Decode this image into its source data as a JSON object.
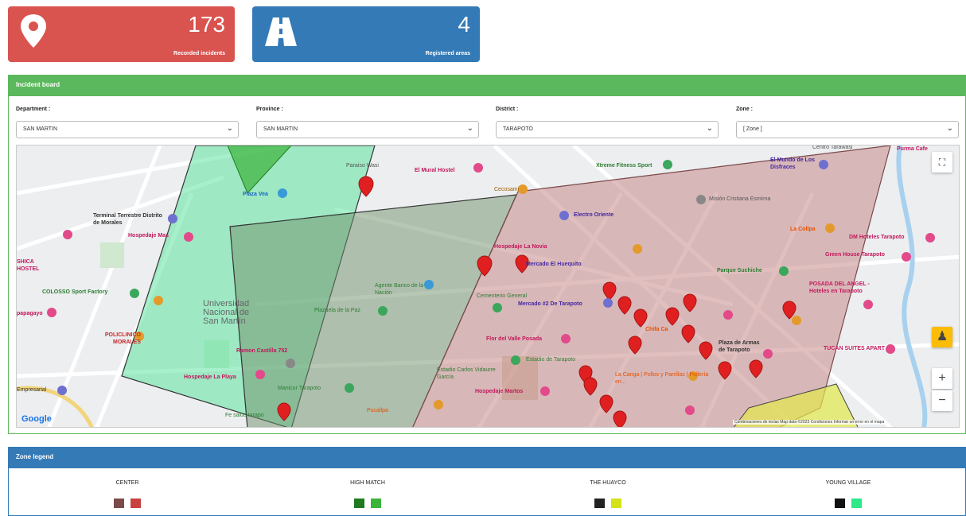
{
  "stats": {
    "incidents": {
      "value": "173",
      "label": "Recorded incidents",
      "color": "#d9534f",
      "icon": "map-pin-icon"
    },
    "areas": {
      "value": "4",
      "label": "Registered areas",
      "color": "#337ab7",
      "icon": "road-icon"
    }
  },
  "board": {
    "title": "Incident board",
    "color": "#5cb85c"
  },
  "filters": {
    "department": {
      "label": "Department :",
      "value": "SAN MARTIN"
    },
    "province": {
      "label": "Province :",
      "value": "SAN MARTIN"
    },
    "district": {
      "label": "District :",
      "value": "TARAPOTO"
    },
    "zone": {
      "label": "Zone :",
      "value": "[ Zone ]"
    }
  },
  "map": {
    "labels": {
      "paraiso": "Paraiso Wasi",
      "mural": "El Mural Hostel",
      "xtreme": "Xtreme Fitness Sport",
      "centro": "Centro Tarawasi",
      "plazavea": "Plaza Vea",
      "cecosami": "Cecosami",
      "electro": "Electro Oriente",
      "mision": "Misión Cristiana Esmirna",
      "terminal": "Terminal Terrestre Distrito de Morales",
      "hospedajemas": "Hospedaje Mas",
      "novia": "Hospedaje La Novia",
      "mercado": "Mercado El Huequito",
      "colpa": "La Collpa",
      "dm": "DM Hoteles Tarapoto",
      "greenhouse": "Green House Tarapoto",
      "suchiche": "Parque Suchiche",
      "shica": "SHICA HOSTEL",
      "colosso": "COLOSSO Sport Factory",
      "agente": "Agente Banco de la Nación",
      "cementerio": "Cementerio General",
      "mercado2": "Mercado #2 De Tarapoto",
      "posada": "POSADA DEL ANGEL - Hoteles en Tarapoto",
      "papagayo": "papagayo",
      "universidad": "Universidad Nacional de San Martín",
      "plazuela": "Plazuela de la Paz",
      "chifa": "Chifa Ca",
      "policlinico": "POLICLINICO MORALES",
      "ramon": "Ramon Castilla 752",
      "flor": "Flor del Valle Posada",
      "plaza": "Plaza de Armas de Tarapoto",
      "tucan": "TUCAN SUITES APART",
      "laplaya": "Hospedaje La Playa",
      "estadio": "Estadio Carlos Vidaurre García",
      "estadiotarapoto": "Estadio de Tarapoto",
      "canga": "La Canga | Pollos y Parrillas | Pollería en...",
      "empresarial": "Empresarial",
      "manicur": "Manicur Tarapoto",
      "martos": "Hospedaje Martos",
      "fesalud": "Fe salud tarapo",
      "pucallpa": "Pucallpa",
      "purma": "Purma Cafe",
      "disfraces": "El Mundo de Los Disfraces",
      "footer": "Combinaciones de teclas   Map data ©2023   Condiciones   Informar un error en el mapa",
      "google": "Google"
    }
  },
  "legend": {
    "title": "Zone legend",
    "items": [
      {
        "name": "CENTER",
        "colors": [
          "#7b4a4a",
          "#c94040"
        ]
      },
      {
        "name": "HIGH MATCH",
        "colors": [
          "#1f7a1f",
          "#3cb43c"
        ]
      },
      {
        "name": "THE HUAYCO",
        "colors": [
          "#222222",
          "#d4e21a"
        ]
      },
      {
        "name": "YOUNG VILLAGE",
        "colors": [
          "#111111",
          "#2ee88a"
        ]
      }
    ]
  }
}
